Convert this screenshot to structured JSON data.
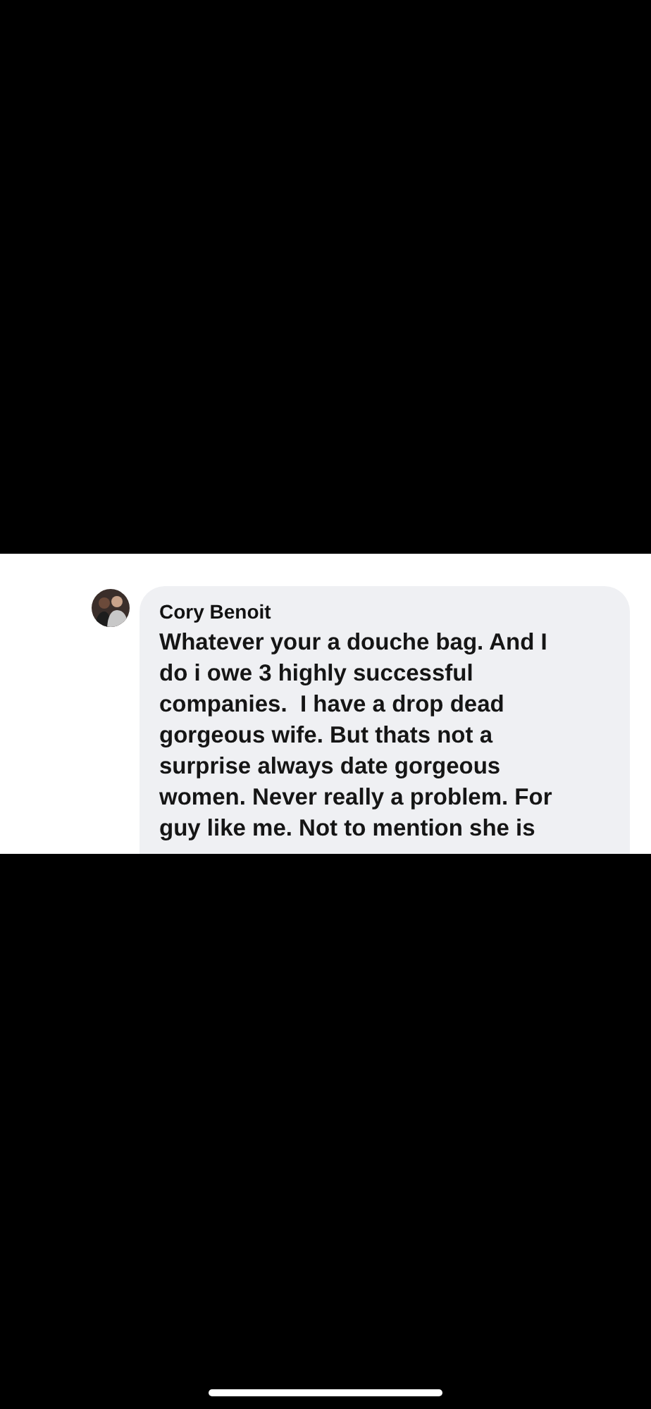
{
  "comment": {
    "author": "Cory Benoit",
    "lines": [
      "Whatever your a douche bag. And I",
      "do i owe 3 highly successful",
      "companies.  I have a drop dead",
      "gorgeous wife. But thats not a",
      "surprise always date gorgeous",
      "women. Never really a problem. For",
      "guy like me. Not to mention she is"
    ]
  }
}
